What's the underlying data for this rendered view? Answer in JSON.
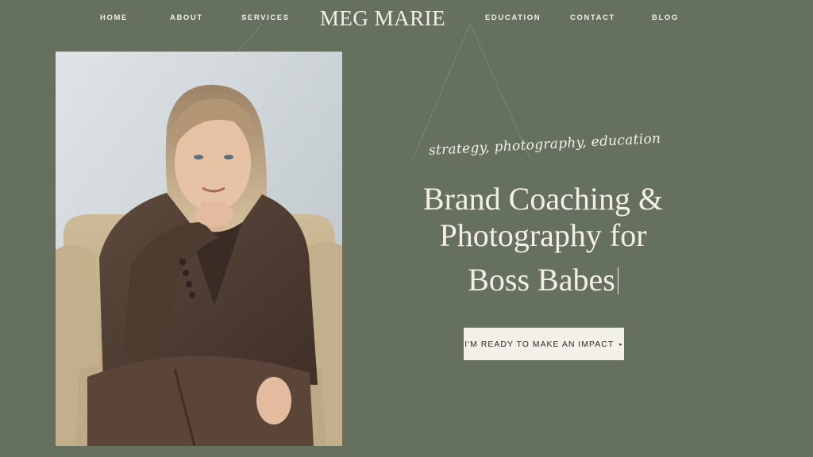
{
  "nav": {
    "home": "HOME",
    "about": "ABOUT",
    "services": "SERVICES",
    "logo": "MEG MARIE",
    "education": "EDUCATION",
    "contact": "CONTACT",
    "blog": "BLOG"
  },
  "hero": {
    "photo_alt": "Portrait of a woman in a brown suit seated in a cream armchair",
    "tagline": "strategy, photography, education",
    "headline_line1": "Brand Coaching &",
    "headline_line2": "Photography for",
    "headline_line3": "Boss Babes",
    "cta_label": "I'M READY TO MAKE AN IMPACT",
    "cta_arrow": "▸"
  },
  "colors": {
    "background": "#66705f",
    "text": "#f3efe7",
    "button_bg": "#f3efe9",
    "button_text": "#2c2c28"
  }
}
